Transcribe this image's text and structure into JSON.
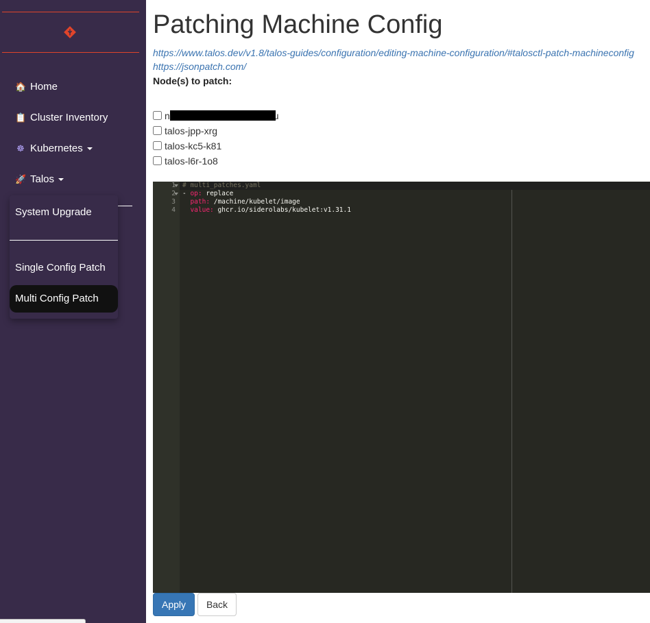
{
  "sidebar": {
    "logo_icon": "talos-logo-icon",
    "items": [
      {
        "emoji": "🏠",
        "icon": "house-icon",
        "label": "Home",
        "has_caret": false
      },
      {
        "emoji": "📋",
        "icon": "clipboard-icon",
        "label": "Cluster Inventory",
        "has_caret": false
      },
      {
        "emoji": "☸",
        "icon": "kubernetes-wheel-icon",
        "label": "Kubernetes",
        "has_caret": true
      },
      {
        "emoji": "🚀",
        "icon": "rocket-icon",
        "label": "Talos",
        "has_caret": true
      }
    ],
    "dropdown": {
      "items": [
        {
          "label": "System Upgrade",
          "active": false
        },
        {
          "label": "Single Config Patch",
          "active": false
        },
        {
          "label": "Multi Config Patch",
          "active": true
        }
      ]
    }
  },
  "main": {
    "title": "Patching Machine Config",
    "links": [
      "https://www.talos.dev/v1.8/talos-guides/configuration/editing-machine-configuration/#talosctl-patch-machineconfig",
      "https://jsonpatch.com/"
    ],
    "nodes_label": "Node(s) to patch:",
    "nodes": [
      {
        "name": "n",
        "suffix": "u",
        "redacted": true,
        "checked": false
      },
      {
        "name": "talos-jpp-xrg",
        "redacted": false,
        "checked": false
      },
      {
        "name": "talos-kc5-k81",
        "redacted": false,
        "checked": false
      },
      {
        "name": "talos-l6r-1o8",
        "redacted": false,
        "checked": false
      }
    ],
    "editor": {
      "lines": [
        {
          "number": "1",
          "text": "# multi_patches.yaml"
        },
        {
          "number": "2",
          "dash": "- ",
          "key": "op:",
          "value": " replace"
        },
        {
          "number": "3",
          "indent": "  ",
          "key": "path:",
          "value": " /machine/kubelet/image"
        },
        {
          "number": "4",
          "indent": "  ",
          "key": "value:",
          "value": " ghcr.io/siderolabs/kubelet:v1.31.1"
        }
      ]
    },
    "buttons": {
      "apply": "Apply",
      "back": "Back"
    }
  },
  "colors": {
    "sidebar_bg": "#382b49",
    "accent_red": "#e0442a",
    "primary_button": "#3776b5",
    "link": "#3a73b0",
    "editor_bg": "#272822"
  }
}
